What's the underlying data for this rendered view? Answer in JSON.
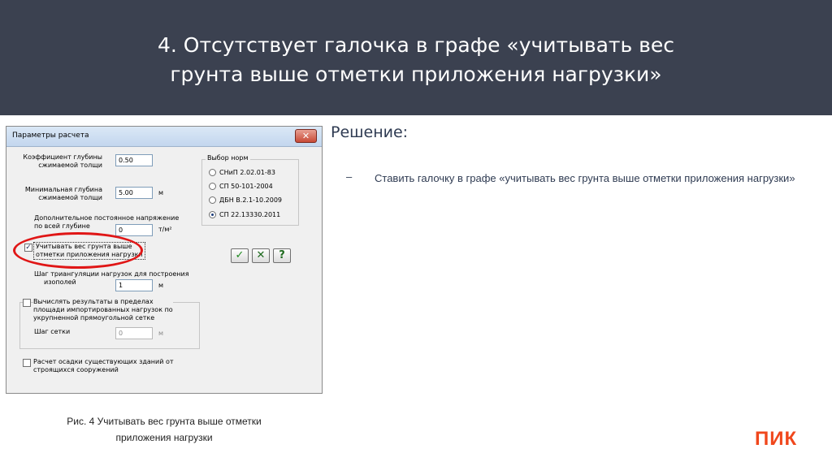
{
  "header": {
    "title_line1": "4. Отсутствует галочка в графе «учитывать вес",
    "title_line2": "грунта выше отметки приложения нагрузки»"
  },
  "dialog": {
    "title": "Параметры расчета",
    "close_label": "✕",
    "coef_label_1": "Коэффициент глубины",
    "coef_label_2": "сжимаемой толщи",
    "coef_value": "0.50",
    "mindepth_label_1": "Минимальная глубина",
    "mindepth_label_2": "сжимаемой толщи",
    "mindepth_value": "5.00",
    "mindepth_unit": "м",
    "pressure_label_1": "Дополнительное постоянное напряжение",
    "pressure_label_2": "по всей глубине",
    "pressure_value": "0",
    "pressure_unit": "т/м²",
    "norms_title": "Выбор норм",
    "norms": [
      {
        "label": "СНиП 2.02.01-83",
        "selected": false
      },
      {
        "label": "СП 50-101-2004",
        "selected": false
      },
      {
        "label": "ДБН В.2.1-10.2009",
        "selected": false
      },
      {
        "label": "СП 22.13330.2011",
        "selected": true
      }
    ],
    "soil_weight_label_1": "Учитывать вес грунта выше",
    "soil_weight_label_2": "отметки приложения нагрузки",
    "soil_weight_checked": true,
    "check_mark": "✓",
    "btn_ok": "✓",
    "btn_cancel": "✕",
    "btn_help": "?",
    "triang_label_1": "Шаг триангуляции нагрузок для построения",
    "triang_label_2": "изополей",
    "triang_value": "1",
    "triang_unit": "м",
    "calc_label_1": "Вычислять результаты в пределах",
    "calc_label_2": "площади импортированных нагрузок по",
    "calc_label_3": "укрупненной прямоугольной сетке",
    "grid_label": "Шаг сетки",
    "grid_value": "0",
    "grid_unit": "м",
    "settle_label_1": "Расчет осадки существующих зданий от",
    "settle_label_2": "строящихся сооружений"
  },
  "caption": {
    "line1": "Рис. 4 Учитывать вес грунта выше отметки",
    "line2": "приложения нагрузки"
  },
  "solution": {
    "title": "Решение:",
    "bullet": "–",
    "text": "Ставить галочку в графе «учитывать вес грунта выше отметки приложения нагрузки»"
  },
  "logo": "ПИК",
  "colors": {
    "header_bg": "#3b4150",
    "accent": "#f0471c",
    "highlight": "#e01616"
  }
}
